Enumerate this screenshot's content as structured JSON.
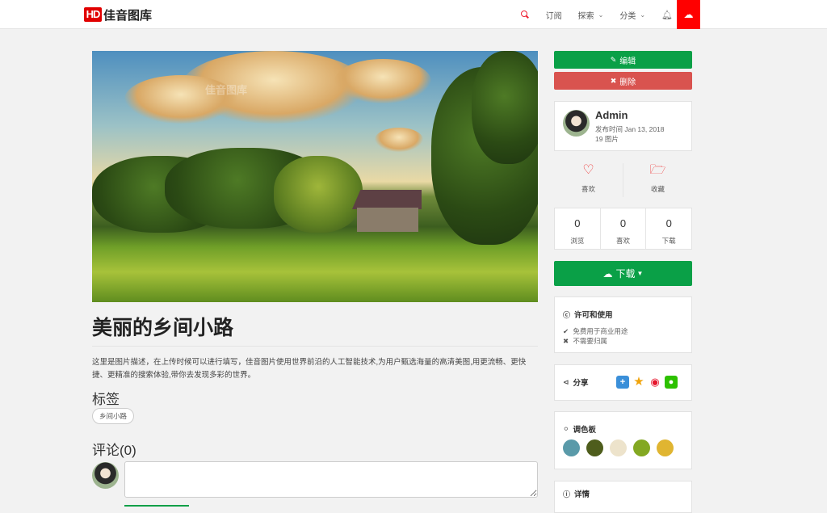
{
  "header": {
    "logo_mark": "HD",
    "logo_text": "佳音图库",
    "nav": {
      "subscribe": "订阅",
      "explore": "探索",
      "category": "分类"
    },
    "icons": {
      "search": "search-icon",
      "bell": "bell-icon",
      "upload": "cloud-upload-icon"
    }
  },
  "photo": {
    "watermark": "佳音图库"
  },
  "main": {
    "title": "美丽的乡间小路",
    "description": "这里是图片描述，在上传时候可以进行填写，佳音图片使用世界前沿的人工智能技术,为用户甄选海量的高清美图,用更流畅、更快捷、更精准的搜索体验,带你去发现多彩的世界。",
    "tags_heading": "标签",
    "tags": [
      "乡间小路"
    ],
    "comments_heading": "评论(0)",
    "comment_placeholder": ""
  },
  "sidebar": {
    "edit_label": "编辑",
    "delete_label": "删除",
    "author": {
      "name": "Admin",
      "published": "发布时间 Jan 13, 2018",
      "count": "19 图片"
    },
    "actions": {
      "like": "喜欢",
      "collect": "收藏"
    },
    "stats": [
      {
        "value": "0",
        "label": "浏览"
      },
      {
        "value": "0",
        "label": "喜欢"
      },
      {
        "value": "0",
        "label": "下载"
      }
    ],
    "download_label": "下载",
    "license": {
      "title": "许可和使用",
      "line1": "免费用于商业用途",
      "line2": "不需要归属"
    },
    "share_title": "分享",
    "palette": {
      "title": "调色板",
      "colors": [
        "#5a9aa9",
        "#4e5d1c",
        "#ede3cb",
        "#83a822",
        "#e0b531"
      ]
    },
    "details_title": "详情"
  }
}
